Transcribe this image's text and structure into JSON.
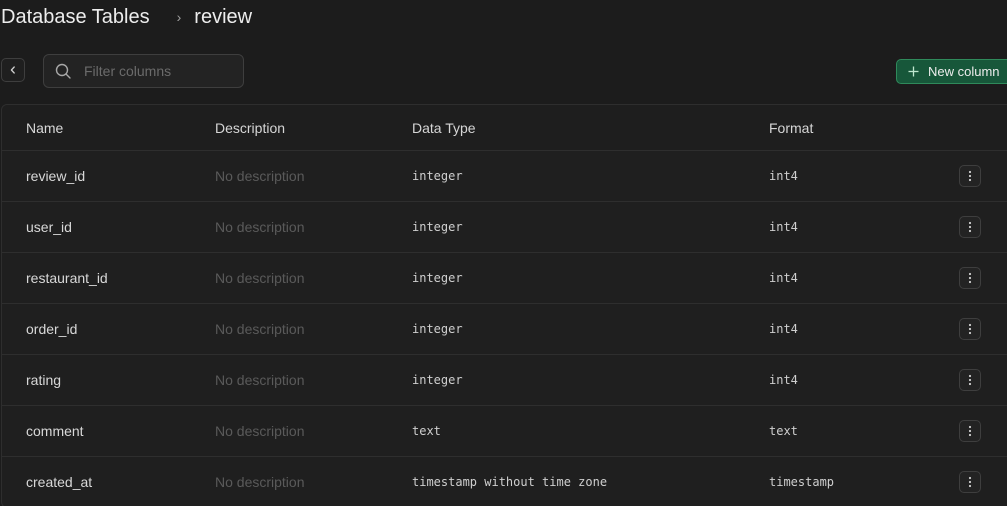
{
  "breadcrumb": {
    "root": "Database Tables",
    "separator": "›",
    "current": "review"
  },
  "toolbar": {
    "back_icon": "chevron-left-icon",
    "search_placeholder": "Filter columns",
    "search_value": "",
    "new_column_label": "New column"
  },
  "table": {
    "headers": {
      "name": "Name",
      "description": "Description",
      "data_type": "Data Type",
      "format": "Format"
    },
    "rows": [
      {
        "name": "review_id",
        "description": "No description",
        "data_type": "integer",
        "format": "int4"
      },
      {
        "name": "user_id",
        "description": "No description",
        "data_type": "integer",
        "format": "int4"
      },
      {
        "name": "restaurant_id",
        "description": "No description",
        "data_type": "integer",
        "format": "int4"
      },
      {
        "name": "order_id",
        "description": "No description",
        "data_type": "integer",
        "format": "int4"
      },
      {
        "name": "rating",
        "description": "No description",
        "data_type": "integer",
        "format": "int4"
      },
      {
        "name": "comment",
        "description": "No description",
        "data_type": "text",
        "format": "text"
      },
      {
        "name": "created_at",
        "description": "No description",
        "data_type": "timestamp without time zone",
        "format": "timestamp"
      }
    ]
  },
  "colors": {
    "background": "#1c1c1c",
    "accent_button": "#17573a",
    "accent_border": "#2f8a5b",
    "muted_text": "#5a5a5a"
  }
}
